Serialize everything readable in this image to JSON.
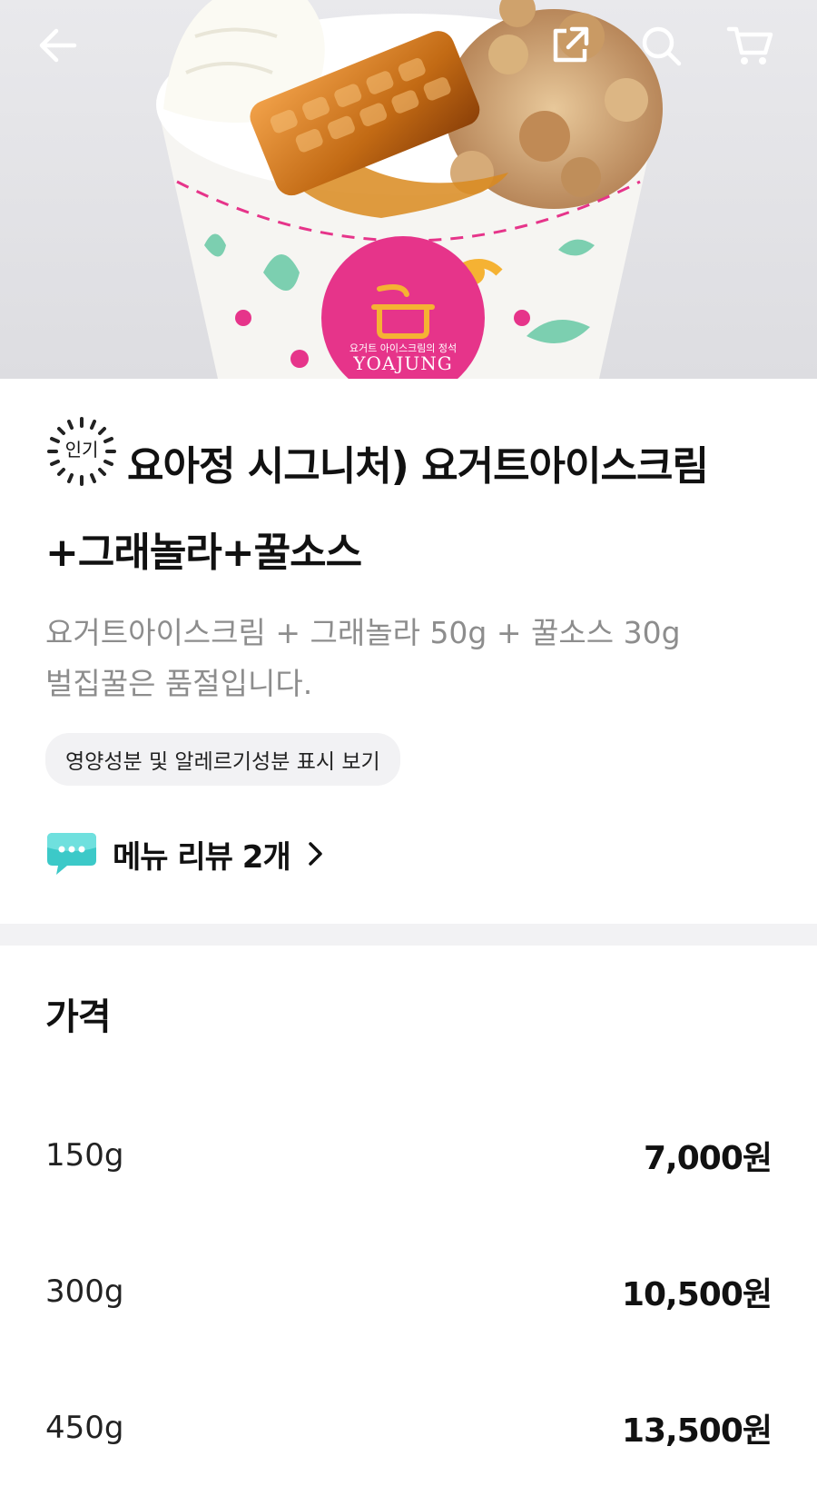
{
  "header": {
    "icons": [
      "back-arrow-icon",
      "share-icon",
      "search-icon",
      "cart-icon"
    ]
  },
  "hero": {
    "brand_caption": "요거트 아이스크림의 정석",
    "brand_name": "YOAJUNG"
  },
  "product": {
    "badge": "인기",
    "name": "요아정 시그니처) 요거트아이스크림+그래놀라+꿀소스",
    "description_line1": "요거트아이스크림 + 그래놀라 50g + 꿀소스 30g",
    "description_line2": "벌집꿀은 품절입니다.",
    "nutrition_label": "영양성분 및 알레르기성분 표시 보기",
    "review_label": "메뉴 리뷰 2개"
  },
  "price": {
    "title": "가격",
    "options": [
      {
        "size": "150g",
        "price": "7,000원"
      },
      {
        "size": "300g",
        "price": "10,500원"
      },
      {
        "size": "450g",
        "price": "13,500원"
      }
    ]
  },
  "colors": {
    "pink": "#e6348a",
    "mint": "#7ccfb0",
    "honey": "#c97a1c",
    "review_icon": "#3cc9c8"
  }
}
